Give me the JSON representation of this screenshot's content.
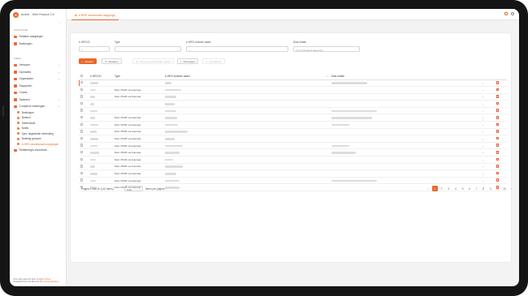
{
  "app": {
    "title": "Archer - Web Finance 2.0",
    "logo_letter": "A"
  },
  "sidebar": {
    "section_navigation": "NAVIGATIE",
    "nav_items": [
      {
        "label": "Relaties raadpleger",
        "icon": "users-icon"
      },
      {
        "label": "Boekingen",
        "icon": "book-icon"
      }
    ],
    "section_menu": "MENU",
    "menu_items": [
      {
        "label": "Verkoper",
        "icon": "cart-icon",
        "has_chevron": true
      },
      {
        "label": "Operaties",
        "icon": "gear-icon",
        "has_chevron": true
      },
      {
        "label": "Organisatie",
        "icon": "building-icon",
        "has_chevron": true
      },
      {
        "label": "Rapporten",
        "icon": "chart-icon",
        "has_chevron": false
      },
      {
        "label": "Charts",
        "icon": "pie-icon",
        "has_chevron": false
      },
      {
        "label": "Systeem",
        "icon": "cog-icon",
        "has_chevron": true
      },
      {
        "label": "Complexe boekingen",
        "icon": "stack-icon",
        "has_chevron": true
      }
    ],
    "sub_items": [
      {
        "label": "Boekingen",
        "active": false
      },
      {
        "label": "Boeken",
        "active": false
      },
      {
        "label": "Stellerelutie",
        "active": false
      },
      {
        "label": "Notes",
        "active": false
      },
      {
        "label": "Sync uitgestelde verbinding",
        "active": false
      },
      {
        "label": "Boeking groepen",
        "active": false
      },
      {
        "label": "e-HRS verzekeraars mappingen",
        "active": true
      }
    ],
    "bottom_item": {
      "label": "Relatieregrs-inventaris...",
      "icon": "users-icon"
    },
    "footer_line1": "Informatie geleverd door",
    "footer_link1": "Finalbio Online",
    "footer_line2": "Ontwikkeld door de Beumax B.V.",
    "footer_link2": "Grote-gebedem"
  },
  "topbar": {
    "tab_label": "e-HRS verzekeraar mappings",
    "icons": [
      "bell-icon",
      "user-icon"
    ]
  },
  "filters": {
    "ehrs_id_label": "e-HRS ID",
    "ehrs_id_value": "=",
    "type_label": "Type",
    "type_value": "",
    "ehrs_name_label": "e-HRS verkorte naam",
    "ehrs_name_value": "",
    "dias_label": "Dias relatie",
    "dias_placeholder": "Typ minimaal 3 tekens(s)"
  },
  "toolbar": {
    "search": "Zoeken",
    "reset": "Resetten",
    "add_relation": "Nieuw geselecteerde relaties",
    "add": "Toevoegen",
    "delete": "Verwijderen"
  },
  "table": {
    "headers": [
      "e-HRS ID",
      "Type",
      "e-HRS verkorte naam",
      "Dias relatie"
    ],
    "rows": [
      {
        "type": "",
        "has_relation": true,
        "active": true
      },
      {
        "type": "Med VHAB verzekeraar",
        "has_relation": false,
        "active": false
      },
      {
        "type": "Med VHAB verzekeraar",
        "has_relation": false,
        "active": false
      },
      {
        "type": "",
        "has_relation": false,
        "active": false
      },
      {
        "type": "",
        "has_relation": true,
        "active": false
      },
      {
        "type": "Med VHAB verzekeraar",
        "has_relation": true,
        "active": false
      },
      {
        "type": "Med VHAB verzekeraar",
        "has_relation": true,
        "active": false
      },
      {
        "type": "Med VHAB verzekeraar",
        "has_relation": false,
        "active": false
      },
      {
        "type": "Med VHAB verzekeraar",
        "has_relation": false,
        "active": false
      },
      {
        "type": "Med VHAB verzekeraar",
        "has_relation": true,
        "active": false
      },
      {
        "type": "Med VHAB verzekeraar",
        "has_relation": true,
        "active": false
      },
      {
        "type": "Med VHAB verzekeraar",
        "has_relation": false,
        "active": false
      },
      {
        "type": "Med VHAB verzekeraar",
        "has_relation": false,
        "active": false
      },
      {
        "type": "Med VHAB verzekeraar",
        "has_relation": false,
        "active": false
      },
      {
        "type": "Med VHAB verzekeraar",
        "has_relation": true,
        "active": false
      },
      {
        "type": "Med VHAB verzekeraar",
        "has_relation": false,
        "active": false
      }
    ]
  },
  "pagination": {
    "summary": "Pagina 1 van 10 (142 items)",
    "page_size": "Auto",
    "items_per_page": "items per pagina",
    "pages": [
      "‹",
      "1",
      "2",
      "3",
      "4",
      "5",
      "6",
      "7",
      "8",
      "9",
      "...",
      "10",
      "›"
    ],
    "active_page": "1"
  },
  "colors": {
    "accent": "#e8692b",
    "delete": "#e25b3b"
  }
}
